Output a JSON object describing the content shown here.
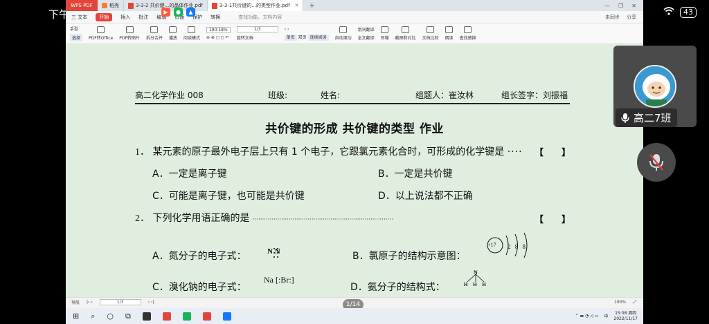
{
  "phone": {
    "time": "下午",
    "battery": "43"
  },
  "window": {
    "tabs": [
      {
        "label": "WPS PDF"
      },
      {
        "label": "稻壳"
      },
      {
        "label": "3-3-2 共价键...的晶体作业.pdf"
      },
      {
        "label": "3-3-1共价键的...的类型作业.pdf"
      }
    ],
    "menu": [
      "三 文本",
      "开始",
      "插入",
      "批注",
      "编辑",
      "页面",
      "保护",
      "转换"
    ],
    "menu_search": "查找功能、文档内容",
    "menu_right": [
      "未同步",
      "分享"
    ],
    "toolbar": {
      "hand": "手型",
      "select": "选择",
      "to_office": "PDF转Office",
      "to_image": "PDF转图片",
      "split": "拆分合并",
      "play": "播放",
      "read_mode": "阅读模式",
      "zoom": "190.18%",
      "page": "1/3",
      "rotate": "旋转文档",
      "single": "单页",
      "double": "双页",
      "continuous": "连续阅读",
      "auto_scroll": "自动滚动",
      "translate": "划词翻译",
      "full_translate": "全文翻译",
      "compress": "压缩",
      "screenshot": "截图和对比",
      "compare": "文档比较",
      "read_aloud": "朗读",
      "find": "查找替换"
    }
  },
  "document": {
    "header": {
      "course": "高二化学作业 008",
      "class": "班级:",
      "name": "姓名:",
      "group": "组题人：崔汝林",
      "sign": "组长签字：刘振福"
    },
    "title": "共价键的形成  共价键的类型      作业",
    "q1": {
      "num": "1．",
      "text": "某元素的原子最外电子层上只有 1 个电子，它跟氯元素化合时，可形成的化学键是",
      "dots": "····",
      "bracket_l": "【",
      "bracket_r": "】",
      "options": [
        "A．一定是离子键",
        "B．一定是共价键",
        "C．可能是离子键，也可能是共价键",
        "D．以上说法都不正确"
      ]
    },
    "q2": {
      "num": "2．",
      "text": "下列化学用语正确的是",
      "dots": "··········································································",
      "bracket_l": "【",
      "bracket_r": "】",
      "options": [
        "A．氮分子的电子式：",
        "B．氯原子的结构示意图：",
        "C．溴化钠的电子式：",
        "D．氨分子的结构式："
      ],
      "formula_n2": "N  N",
      "formula_nabr": "Na [:Br:]",
      "cl_nucleus": "+17",
      "cl_shells": "2  8  8",
      "nh3_n": "N",
      "nh3_h": "H  H  H"
    }
  },
  "viewer": {
    "nav": "导航",
    "page": "1/3",
    "indicator": "1/14",
    "zoom": "190%"
  },
  "taskbar": {
    "time": "15:08 周四",
    "date": "2022/11/17",
    "lang": "中"
  },
  "meeting": {
    "participant_name": "高二7班"
  }
}
